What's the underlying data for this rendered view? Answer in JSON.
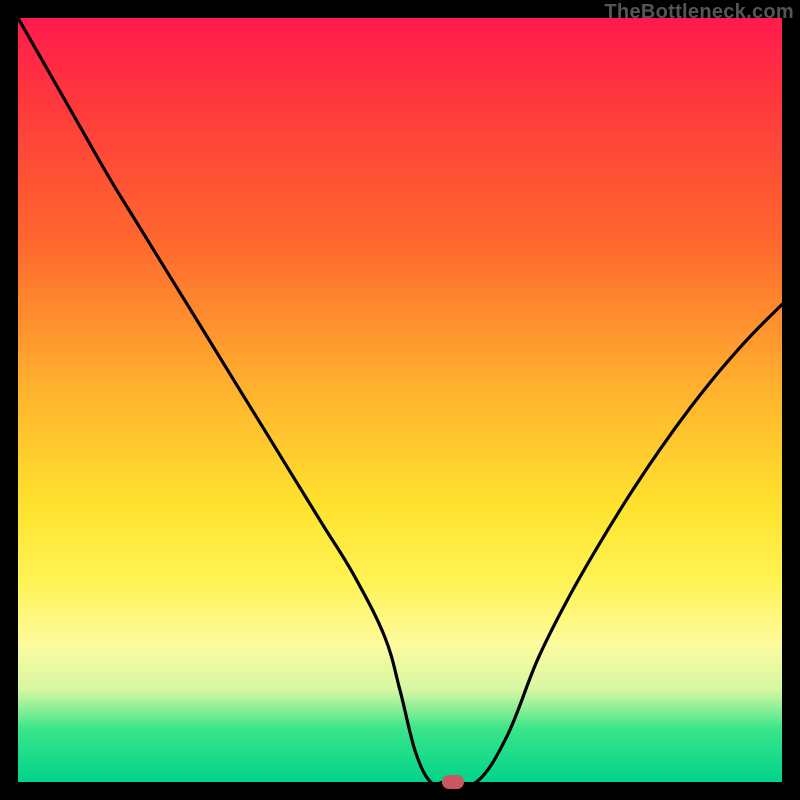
{
  "watermark": "TheBottleneck.com",
  "chart_data": {
    "type": "line",
    "title": "",
    "xlabel": "",
    "ylabel": "",
    "xlim": [
      0,
      100
    ],
    "ylim": [
      0,
      100
    ],
    "series": [
      {
        "name": "curve",
        "x": [
          0,
          4,
          8,
          12,
          16,
          20,
          24,
          28,
          32,
          36,
          40,
          44,
          48,
          50,
          52,
          54,
          56,
          60,
          64,
          68,
          72,
          76,
          80,
          84,
          88,
          92,
          96,
          100
        ],
        "y": [
          100,
          93,
          86,
          79,
          72.5,
          66,
          59.5,
          53,
          46.5,
          40,
          33.5,
          27,
          19,
          12,
          4,
          0,
          0,
          0,
          6,
          16,
          24,
          31,
          37.5,
          43.5,
          49,
          54,
          58.5,
          62.5
        ]
      }
    ],
    "marker": {
      "x": 57,
      "y": 0
    },
    "gradient_stops": [
      {
        "pos": 0,
        "color": "#ff1a4d"
      },
      {
        "pos": 12,
        "color": "#ff3b3b"
      },
      {
        "pos": 30,
        "color": "#ff6a2e"
      },
      {
        "pos": 48,
        "color": "#ffb02e"
      },
      {
        "pos": 64,
        "color": "#ffe32e"
      },
      {
        "pos": 74,
        "color": "#fff356"
      },
      {
        "pos": 82,
        "color": "#fdfb9e"
      },
      {
        "pos": 88,
        "color": "#d6f7a3"
      },
      {
        "pos": 93,
        "color": "#3be58a"
      },
      {
        "pos": 100,
        "color": "#00d38a"
      }
    ]
  }
}
